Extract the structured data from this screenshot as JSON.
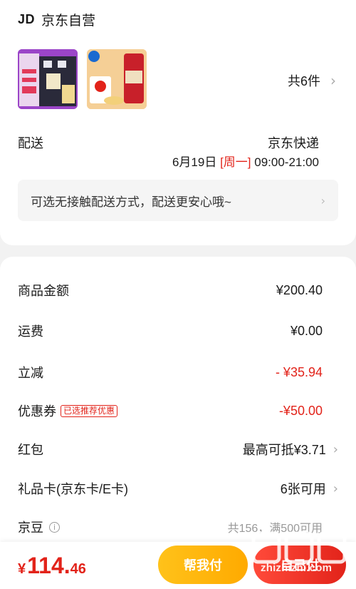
{
  "shop": {
    "logo": "JD",
    "name": "京东自营"
  },
  "products": {
    "count_label": "共6件"
  },
  "shipping": {
    "label": "配送",
    "method": "京东快递",
    "date": "6月19日",
    "weekday": "[周一]",
    "time": "09:00-21:00"
  },
  "notice": {
    "text": "可选无接触配送方式，配送更安心哦~"
  },
  "summary": [
    {
      "label": "商品金额",
      "value": "¥200.40"
    },
    {
      "label": "运费",
      "value": "¥0.00"
    },
    {
      "label": "立减",
      "value": "- ¥35.94"
    },
    {
      "label": "优惠券",
      "tag": "已选推荐优惠",
      "value": "-¥50.00"
    },
    {
      "label": "红包",
      "value": "最高可抵¥3.71"
    },
    {
      "label": "礼品卡(京东卡/E卡)",
      "value": "6张可用"
    },
    {
      "label": "京豆",
      "value": "共156，满500可用"
    }
  ],
  "footer": {
    "currency": "¥",
    "total_int": "114.",
    "total_dec": "46",
    "help_pay_label": "帮我付",
    "self_pay_label": "自己付"
  },
  "watermark": {
    "text": "zhizhizhi.com"
  },
  "colors": {
    "accent_red": "#e2231a",
    "help_yellow": "#ffb400"
  }
}
